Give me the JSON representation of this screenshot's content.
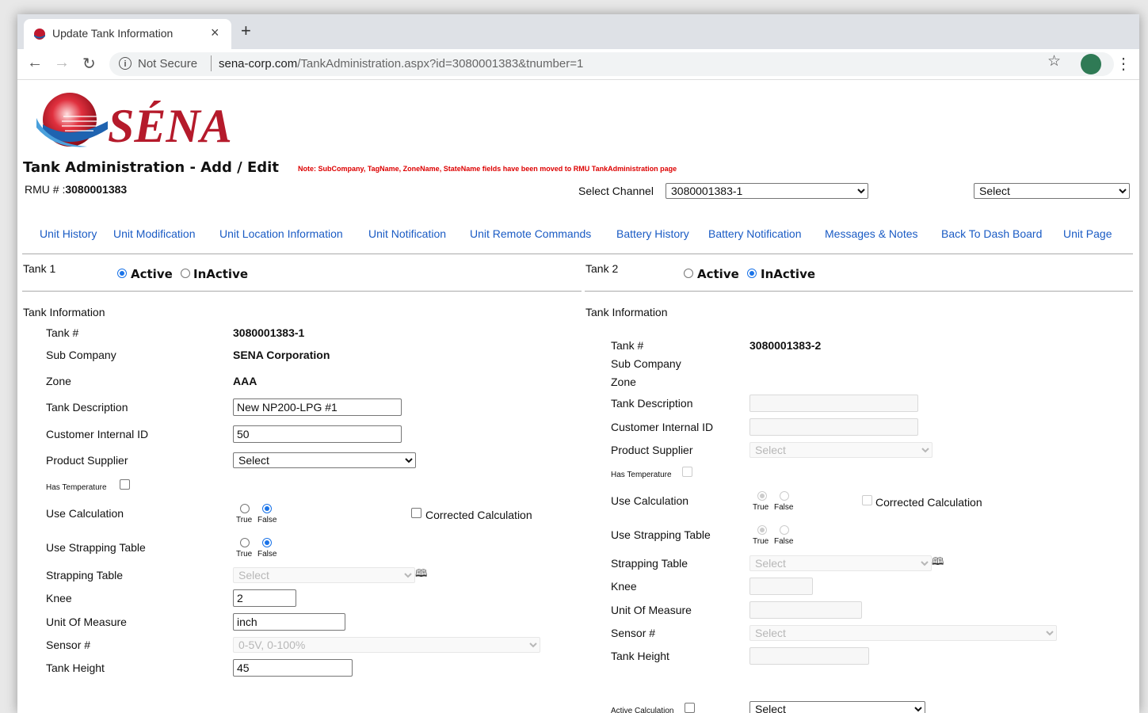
{
  "browser": {
    "tab_title": "Update Tank Information",
    "not_secure": "Not Secure",
    "url_host": "sena-corp.com",
    "url_path": "/TankAdministration.aspx?id=3080001383&tnumber=1"
  },
  "header": {
    "logo_text": "SÉNA",
    "title": "Tank Administration - Add / Edit",
    "note": "Note: SubCompany, TagName, ZoneName, StateName fields have been moved to RMU TankAdministration page",
    "rmu_label": "RMU # :",
    "rmu_value": "3080001383",
    "channel_label": "Select Channel",
    "channel_value": "3080001383-1",
    "right_select_value": "Select"
  },
  "nav_links": [
    "Unit History",
    "Unit Modification",
    "Unit Location Information",
    "Unit Notification",
    "Unit Remote Commands",
    "Battery History",
    "Battery Notification",
    "Messages & Notes",
    "Back To Dash Board",
    "Unit Page"
  ],
  "labels": {
    "active": "Active",
    "inactive": "InActive",
    "tank_information": "Tank Information",
    "tank_no": "Tank #",
    "sub_company": "Sub Company",
    "zone": "Zone",
    "tank_description": "Tank Description",
    "customer_internal_id": "Customer Internal ID",
    "product_supplier": "Product Supplier",
    "has_temperature": "Has Temperature",
    "use_calculation": "Use Calculation",
    "corrected_calculation": "Corrected Calculation",
    "use_strapping_table": "Use Strapping Table",
    "strapping_table": "Strapping Table",
    "knee": "Knee",
    "unit_of_measure": "Unit Of Measure",
    "sensor_no": "Sensor #",
    "tank_height": "Tank Height",
    "true": "True",
    "false": "False",
    "active_calculation": "Active Calculation"
  },
  "tank1": {
    "heading": "Tank 1",
    "status": "Active",
    "tank_no": "3080001383-1",
    "sub_company": "SENA Corporation",
    "zone": "AAA",
    "tank_description": "New NP200-LPG #1",
    "customer_internal_id": "50",
    "product_supplier": "Select",
    "has_temperature": false,
    "use_calculation": "False",
    "corrected_calculation": false,
    "use_strapping_table": "False",
    "strapping_table": "Select",
    "knee": "2",
    "unit_of_measure": "inch",
    "sensor": "0-5V, 0-100%",
    "tank_height": "45"
  },
  "tank2": {
    "heading": "Tank 2",
    "status": "InActive",
    "tank_no": "3080001383-2",
    "product_supplier": "Select",
    "use_calculation": "True",
    "use_strapping_table": "True",
    "strapping_table": "Select",
    "sensor": "Select",
    "active_calculation_select": "Select"
  }
}
